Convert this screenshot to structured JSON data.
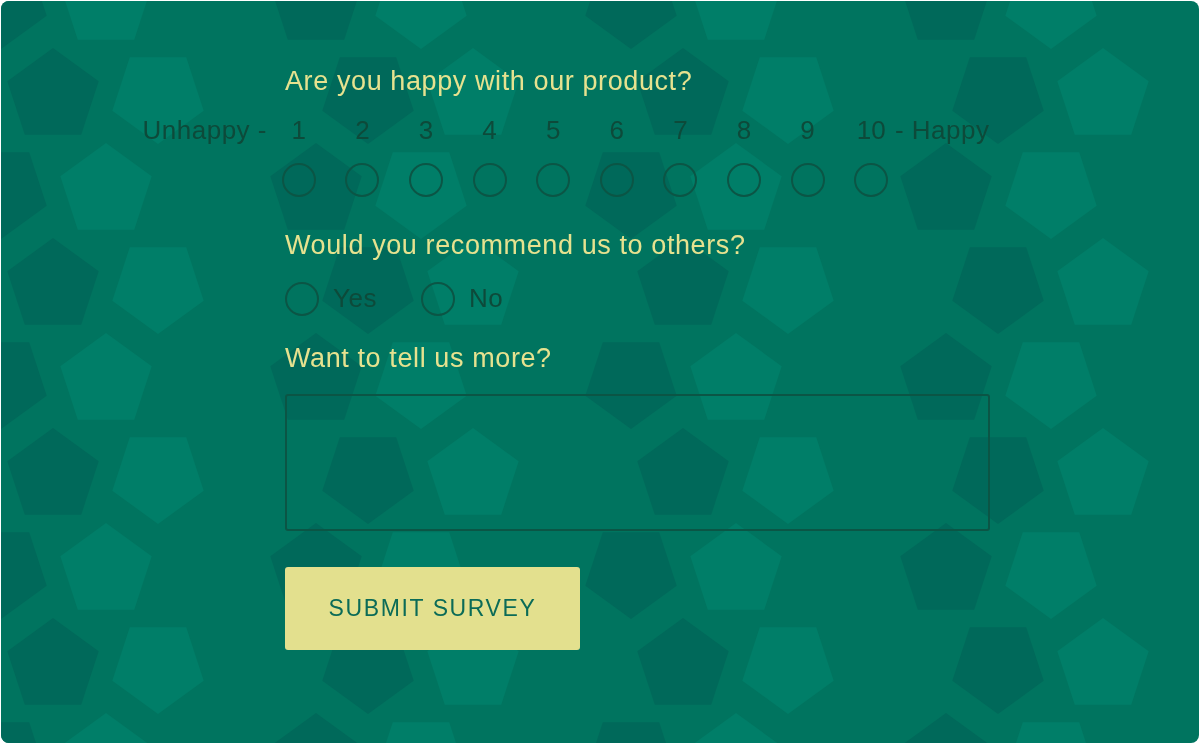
{
  "questions": [
    {
      "kind": "scale",
      "title": "Are you happy with our product?",
      "low_label": "Unhappy -",
      "high_label": "- Happy",
      "options": [
        {
          "label": "1",
          "selected": false
        },
        {
          "label": "2",
          "selected": false
        },
        {
          "label": "3",
          "selected": false
        },
        {
          "label": "4",
          "selected": false
        },
        {
          "label": "5",
          "selected": false
        },
        {
          "label": "6",
          "selected": false
        },
        {
          "label": "7",
          "selected": false
        },
        {
          "label": "8",
          "selected": false
        },
        {
          "label": "9",
          "selected": false
        },
        {
          "label": "10",
          "selected": false
        }
      ]
    },
    {
      "kind": "choice",
      "title": "Would you recommend us to others?",
      "options": [
        {
          "label": "Yes",
          "selected": false
        },
        {
          "label": "No",
          "selected": false
        }
      ]
    },
    {
      "kind": "text",
      "title": "Want to tell us more?"
    }
  ],
  "submit": "SUBMIT SURVEY"
}
